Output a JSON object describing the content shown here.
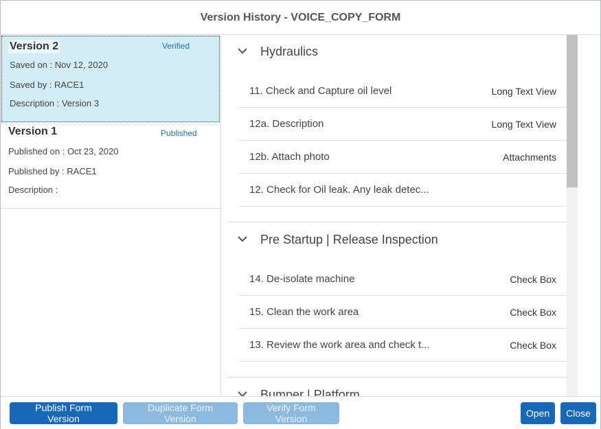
{
  "dialog": {
    "title": "Version History - VOICE_COPY_FORM"
  },
  "versions": [
    {
      "name": "Version 2",
      "status": "Verified",
      "line1": "Saved on : Nov 12, 2020",
      "line2": "Saved by : RACE1",
      "line3": "Description : Version 3",
      "selected": true
    },
    {
      "name": "Version 1",
      "status": "Published",
      "line1": "Published on : Oct 23, 2020",
      "line2": "Published by : RACE1",
      "line3": "Description :",
      "selected": false
    }
  ],
  "sections": [
    {
      "title": "Hydraulics",
      "items": [
        {
          "label": "11. Check and Capture oil level",
          "type": "Long Text View"
        },
        {
          "label": "12a. Description",
          "type": "Long Text View"
        },
        {
          "label": "12b. Attach photo",
          "type": "Attachments"
        },
        {
          "label": "12. Check for Oil leak. Any leak detec...",
          "type": ""
        }
      ]
    },
    {
      "title": "Pre Startup | Release Inspection",
      "items": [
        {
          "label": "14. De-isolate machine",
          "type": "Check Box"
        },
        {
          "label": "15. Clean the work area",
          "type": "Check Box"
        },
        {
          "label": "13. Review the work area and check t...",
          "type": "Check Box"
        }
      ]
    },
    {
      "title": "Bumper | Platform",
      "items": []
    }
  ],
  "footer": {
    "publish_label": "Publish Form Version",
    "duplicate_label": "Duplicate Form Version",
    "verify_label": "Verify Form Version",
    "open_label": "Open",
    "close_label": "Close"
  },
  "colors": {
    "selected_bg": "#d3edf6",
    "status_link": "#1a73c6",
    "primary_button": "#1769b8",
    "disabled_button": "#8cb9df"
  },
  "icons": {
    "section_toggle": "chevron-down-icon"
  }
}
